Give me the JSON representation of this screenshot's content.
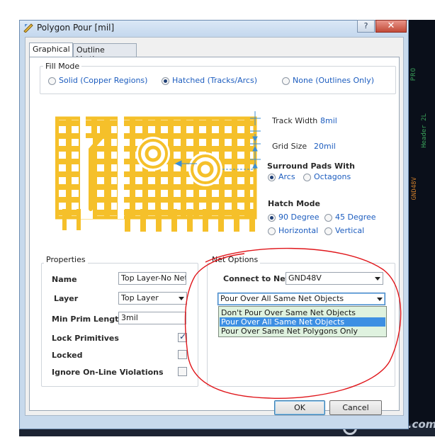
{
  "window": {
    "title": "Polygon Pour [mil]",
    "help_glyph": "?",
    "close_glyph": "✕"
  },
  "tabs": [
    {
      "label": "Graphical"
    },
    {
      "label": "Outline Vertices"
    }
  ],
  "fill_mode": {
    "title": "Fill Mode",
    "options": [
      "Solid (Copper Regions)",
      "Hatched (Tracks/Arcs)",
      "None (Outlines Only)"
    ],
    "selected": "Hatched (Tracks/Arcs)"
  },
  "preview": {
    "track_width_label": "Track Width",
    "track_width_value": "8mil",
    "grid_size_label": "Grid Size",
    "grid_size_value": "20mil",
    "copper_color": "#f5c02a"
  },
  "surround_pads": {
    "title": "Surround Pads With",
    "options": [
      "Arcs",
      "Octagons"
    ],
    "selected": "Arcs"
  },
  "hatch_mode": {
    "title": "Hatch Mode",
    "options": [
      "90 Degree",
      "45 Degree",
      "Horizontal",
      "Vertical"
    ],
    "selected": "90 Degree"
  },
  "properties": {
    "title": "Properties",
    "name_label": "Name",
    "name_value": "Top Layer-No Net",
    "layer_label": "Layer",
    "layer_value": "Top Layer",
    "min_prim_label": "Min Prim Length",
    "min_prim_value": "3mil",
    "lock_primitives_label": "Lock Primitives",
    "lock_primitives_checked": true,
    "locked_label": "Locked",
    "locked_checked": false,
    "ignore_label": "Ignore On-Line Violations",
    "ignore_checked": false
  },
  "net_options": {
    "title": "Net Options",
    "connect_label": "Connect to Net",
    "connect_value": "GND48V",
    "pour_value": "Pour Over All Same Net Objects",
    "pour_options": [
      "Don't Pour Over Same Net Objects",
      "Pour Over All Same Net Objects",
      "Pour Over Same Net Polygons Only"
    ],
    "selected_index": 1,
    "annotation_color": "#e0161b"
  },
  "buttons": {
    "ok": "OK",
    "cancel": "Cancel"
  },
  "background": {
    "side_text_1": "PRO",
    "side_text_2": "Header 2L",
    "side_text_3": "GND48V",
    "watermark": "eeworld.com.cn"
  }
}
